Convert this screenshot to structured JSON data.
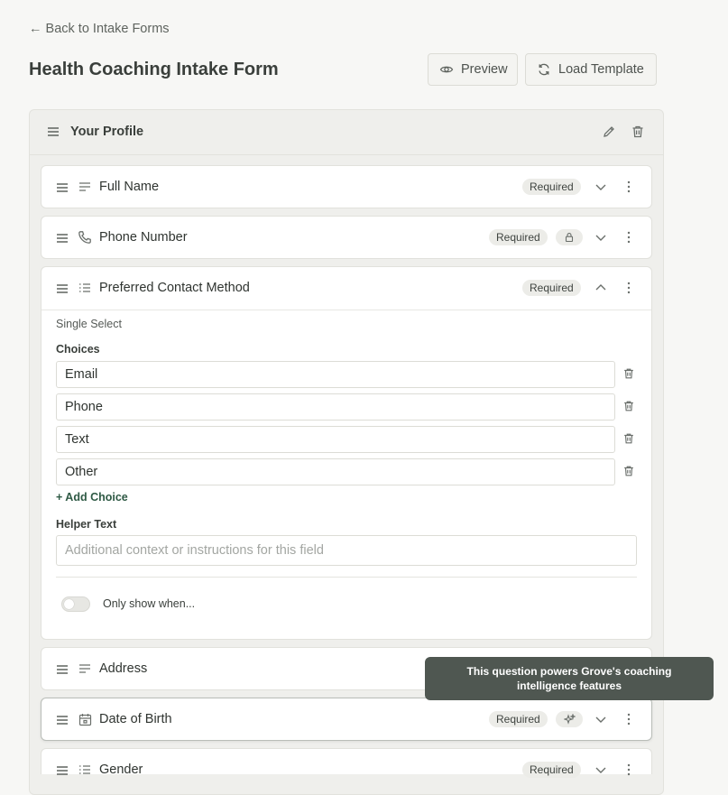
{
  "nav": {
    "back_label": "← Back to Intake Forms"
  },
  "page": {
    "title": "Health Coaching Intake Form"
  },
  "header_buttons": {
    "preview": "Preview",
    "load_template": "Load Template"
  },
  "section": {
    "title": "Your Profile"
  },
  "fields": [
    {
      "label": "Full Name",
      "badge": "Required",
      "icon": "short-text-icon"
    },
    {
      "label": "Phone Number",
      "badge": "Required",
      "icon": "phone-icon",
      "extra_icon": "lock-icon"
    },
    {
      "label": "Preferred Contact Method",
      "badge": "Required",
      "icon": "list-icon",
      "expanded": true
    },
    {
      "label": "Address",
      "icon": "short-text-icon"
    },
    {
      "label": "Date of Birth",
      "badge": "Required",
      "icon": "calendar-icon",
      "extra_icon": "sparkle-icon"
    },
    {
      "label": "Gender",
      "badge": "Required",
      "icon": "list-icon"
    }
  ],
  "expanded_field": {
    "type_label": "Single Select",
    "choices_label": "Choices",
    "choices": [
      "Email",
      "Phone",
      "Text",
      "Other"
    ],
    "add_choice": "+ Add Choice",
    "helper_label": "Helper Text",
    "helper_placeholder": "Additional context or instructions for this field",
    "condition_label": "Only show when...",
    "condition_enabled": false
  },
  "tooltip": {
    "text": "This question powers Grove's coaching intelligence features"
  },
  "colors": {
    "accent_green": "#2f5a45",
    "tooltip_bg": "#4f5751",
    "badge_bg": "#ecece8"
  }
}
